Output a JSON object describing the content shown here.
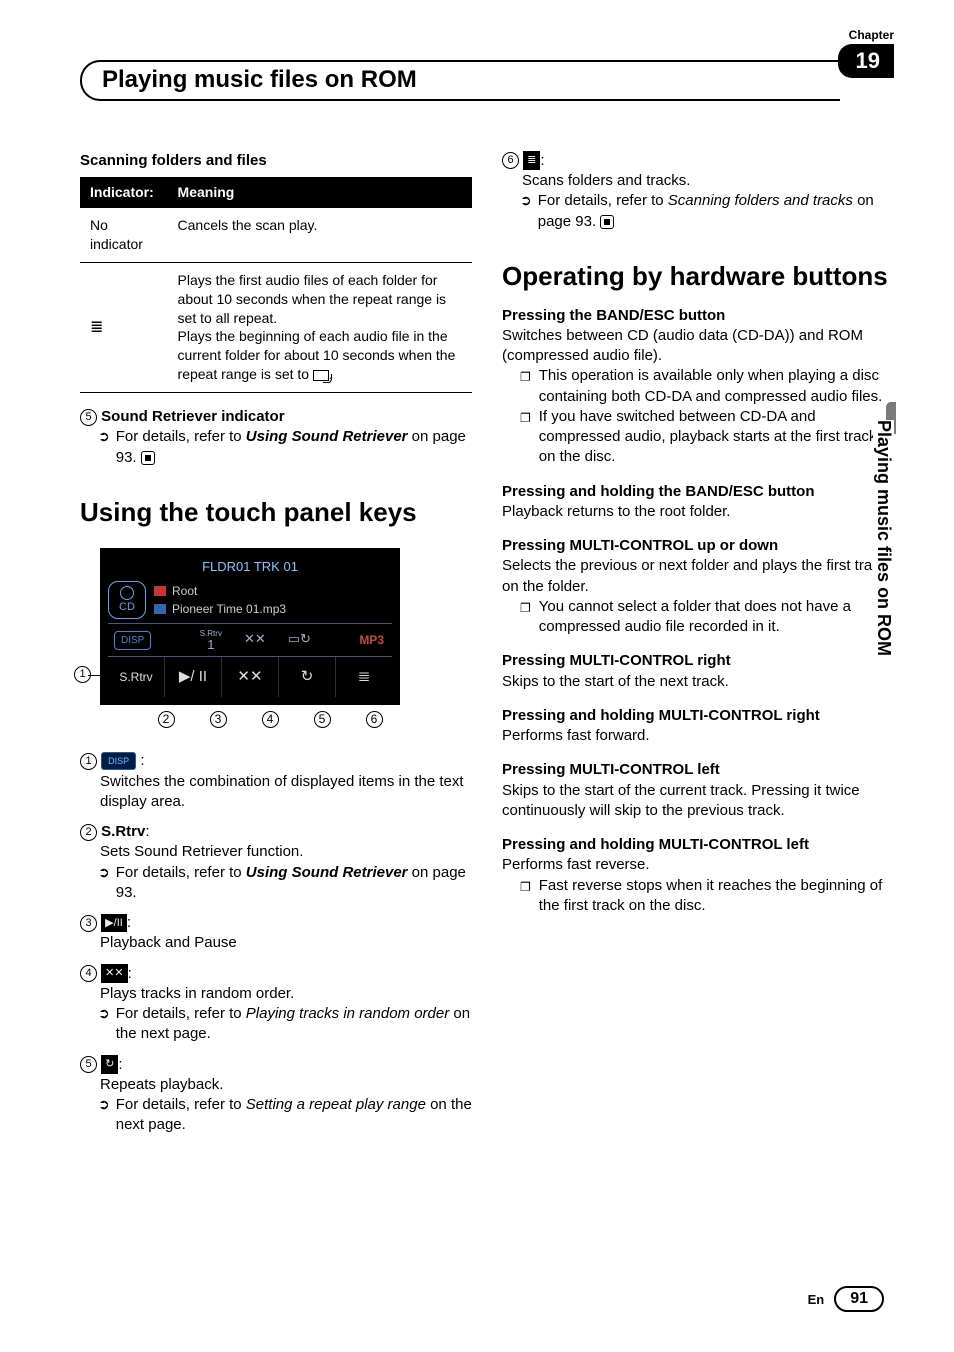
{
  "header": {
    "chapter_label": "Chapter",
    "chapter_number": "19",
    "title": "Playing music files on ROM"
  },
  "side_tab": "Playing music files on ROM",
  "footer": {
    "lang": "En",
    "page": "91"
  },
  "left": {
    "scan_heading": "Scanning folders and files",
    "table": {
      "h1": "Indicator:",
      "h2": "Meaning",
      "r1c1": "No indicator",
      "r1c2": "Cancels the scan play.",
      "r2c2a": "Plays the first audio files of each folder for about 10 seconds when the repeat range is set to all repeat.",
      "r2c2b": "Plays the beginning of each audio file in the current folder for about 10 seconds when the repeat range is set to ",
      "r2c2c": "."
    },
    "item5": {
      "num": "5",
      "title": "Sound Retriever indicator",
      "ref_pre": "For details, refer to ",
      "ref_link": "Using Sound Retriever",
      "ref_post": " on page 93."
    },
    "section_touch": "Using the touch panel keys",
    "device": {
      "track": "FLDR01 TRK 01",
      "root": "Root",
      "file": "Pioneer Time 01.mp3",
      "cd": "CD",
      "disp": "DISP",
      "srtrv_small": "S.Rtrv",
      "one": "1",
      "mp3": "MP3",
      "b_srtrv": "S.Rtrv",
      "b_play": "▶/ II",
      "b_shuffle": "✕✕",
      "b_repeat": "↻",
      "b_list": "≣"
    },
    "callouts": {
      "c1": "1",
      "c2": "2",
      "c3": "3",
      "c4": "4",
      "c5": "5",
      "c6": "6"
    },
    "touch": {
      "i1": {
        "n": "1",
        "body": "Switches the combination of displayed items in the text display area."
      },
      "i2": {
        "n": "2",
        "label": "S.Rtrv",
        "body": "Sets Sound Retriever function.",
        "ref_pre": "For details, refer to ",
        "ref_link": "Using Sound Retriever",
        "ref_post": " on page 93."
      },
      "i3": {
        "n": "3",
        "body": "Playback and Pause"
      },
      "i4": {
        "n": "4",
        "body": "Plays tracks in random order.",
        "ref_pre": "For details, refer to ",
        "ref_link": "Playing tracks in random order",
        "ref_post": " on the next page."
      },
      "i5": {
        "n": "5",
        "body": "Repeats playback.",
        "ref_pre": "For details, refer to ",
        "ref_link": "Setting a repeat play range",
        "ref_post": " on the next page."
      }
    }
  },
  "right": {
    "i6": {
      "n": "6",
      "body": "Scans folders and tracks.",
      "ref_pre": "For details, refer to ",
      "ref_link": "Scanning folders and tracks",
      "ref_post": " on page 93."
    },
    "section_hw": "Operating by hardware buttons",
    "a1": {
      "h": "Pressing the BAND/ESC button",
      "p": "Switches between CD (audio data (CD-DA)) and ROM (compressed audio file).",
      "b1": "This operation is available only when playing a disc containing both CD-DA and compressed audio files.",
      "b2": "If you have switched between CD-DA and compressed audio, playback starts at the first track on the disc."
    },
    "a2": {
      "h": "Pressing and holding the BAND/ESC button",
      "p": "Playback returns to the root folder."
    },
    "a3": {
      "h": "Pressing MULTI-CONTROL up or down",
      "p": "Selects the previous or next folder and plays the first track on the folder.",
      "b1": "You cannot select a folder that does not have a compressed audio file recorded in it."
    },
    "a4": {
      "h": "Pressing MULTI-CONTROL right",
      "p": "Skips to the start of the next track."
    },
    "a5": {
      "h": "Pressing and holding MULTI-CONTROL right",
      "p": "Performs fast forward."
    },
    "a6": {
      "h": "Pressing MULTI-CONTROL left",
      "p": "Skips to the start of the current track. Pressing it twice continuously will skip to the previous track."
    },
    "a7": {
      "h": "Pressing and holding MULTI-CONTROL left",
      "p": "Performs fast reverse.",
      "b1": "Fast reverse stops when it reaches the beginning of the first track on the disc."
    }
  }
}
